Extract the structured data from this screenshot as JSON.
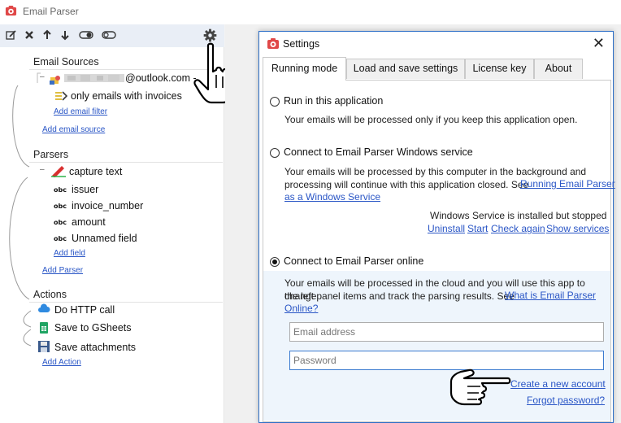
{
  "app": {
    "title": "Email Parser"
  },
  "sections": {
    "email_sources": "Email Sources",
    "parsers": "Parsers",
    "actions": "Actions"
  },
  "tree": {
    "email_account": "@outlook.com -",
    "filter": "only emails with invoices",
    "add_email_filter": "Add email filter",
    "add_email_source": "Add email source",
    "parser": "capture text",
    "fields": [
      {
        "tag": "obc",
        "label": "issuer"
      },
      {
        "tag": "obc",
        "label": "invoice_number"
      },
      {
        "tag": "obc",
        "label": "amount"
      },
      {
        "tag": "obc",
        "label": "Unnamed field"
      }
    ],
    "add_field": "Add field",
    "add_parser": "Add Parser",
    "actions": [
      {
        "label": "Do HTTP call",
        "icon": "cloud-icon"
      },
      {
        "label": "Save to GSheets",
        "icon": "sheets-icon"
      },
      {
        "label": "Save attachments",
        "icon": "floppy-disk-icon"
      }
    ],
    "add_action": "Add Action"
  },
  "dialog": {
    "title": "Settings",
    "close": "✕",
    "tabs": [
      "Running mode",
      "Load and save settings",
      "License key",
      "About"
    ],
    "active_tab": 0,
    "options": [
      {
        "label": "Run in this application",
        "selected": false,
        "description": "Your emails will be processed only if you keep this application open."
      },
      {
        "label": "Connect to Email Parser Windows service",
        "selected": false,
        "description_1": "Your emails will be processed by this computer in the background and",
        "description_2": "processing will continue with this application closed. See",
        "link_1": "Running Email Parser",
        "link_2": "as a Windows Service",
        "service_status": "Windows Service is installed but stopped",
        "service_links": [
          "Uninstall",
          "Start",
          "Check again",
          "Show services"
        ]
      },
      {
        "label": "Connect to Email Parser online",
        "selected": true,
        "description_1": "Your emails will be processed in the cloud and you will use this app to change",
        "description_2": "the left panel items and track the parsing results. See",
        "link_1": "What is Email Parser",
        "link_2": "Online?"
      }
    ],
    "email_placeholder": "Email address",
    "password_placeholder": "Password",
    "create_account": "Create a new account",
    "forgot_password": "Forgot password?"
  },
  "colors": {
    "accent": "#2d6fc7",
    "link": "#2a56c6",
    "toolbar": "#e9eef6",
    "online_panel": "#eef5fc"
  }
}
